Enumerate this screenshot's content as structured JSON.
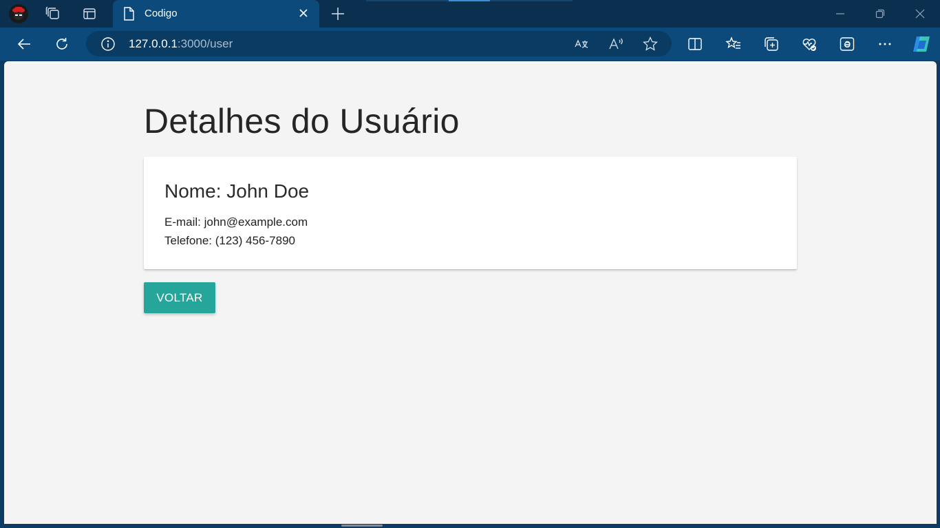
{
  "browser": {
    "tab": {
      "title": "Codigo"
    },
    "address_bar": {
      "url_host": "127.0.0.1",
      "url_path": ":3000/user"
    },
    "colors": {
      "titlebar": "#0b2f4f",
      "toolbar": "#0c4a7c",
      "accent": "#26a69a"
    }
  },
  "page": {
    "heading": "Detalhes do Usuário",
    "card": {
      "name": "Nome: John Doe",
      "email": "E-mail: john@example.com",
      "phone": "Telefone: (123) 456-7890"
    },
    "back_button": "VOLTAR"
  },
  "icons": {
    "titlebar": [
      "profile-avatar-icon",
      "workspaces-icon",
      "tab-actions-icon",
      "document-icon",
      "close-icon",
      "plus-icon",
      "minimize-icon",
      "restore-icon",
      "window-close-icon"
    ],
    "toolbar": [
      "back-arrow-icon",
      "refresh-icon",
      "info-icon",
      "translate-icon",
      "read-aloud-icon",
      "favorite-star-icon",
      "split-screen-icon",
      "favorites-icon",
      "collections-icon",
      "browser-essentials-icon",
      "internet-explorer-mode-icon",
      "more-icon",
      "copilot-icon"
    ]
  }
}
